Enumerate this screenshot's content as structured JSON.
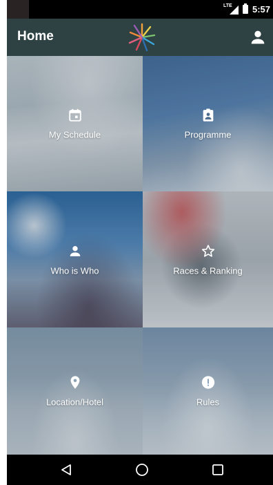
{
  "status_bar": {
    "network_label": "LTE",
    "time": "5:57"
  },
  "app_bar": {
    "title": "Home",
    "logo_icon": "starburst-logo",
    "account_icon": "person-icon"
  },
  "tiles": [
    {
      "label": "My Schedule",
      "icon": "calendar-icon"
    },
    {
      "label": "Programme",
      "icon": "badge-icon"
    },
    {
      "label": "Who is Who",
      "icon": "person-icon"
    },
    {
      "label": "Races & Ranking",
      "icon": "star-outline-icon"
    },
    {
      "label": "Location/Hotel",
      "icon": "location-pin-icon"
    },
    {
      "label": "Rules",
      "icon": "exclamation-circle-icon"
    }
  ],
  "nav_bar": {
    "back_icon": "back-triangle-icon",
    "home_icon": "home-circle-icon",
    "recents_icon": "recents-square-icon"
  },
  "colors": {
    "app_bar": "#2e4244",
    "status_bar": "#000000",
    "nav_bar": "#000000"
  }
}
